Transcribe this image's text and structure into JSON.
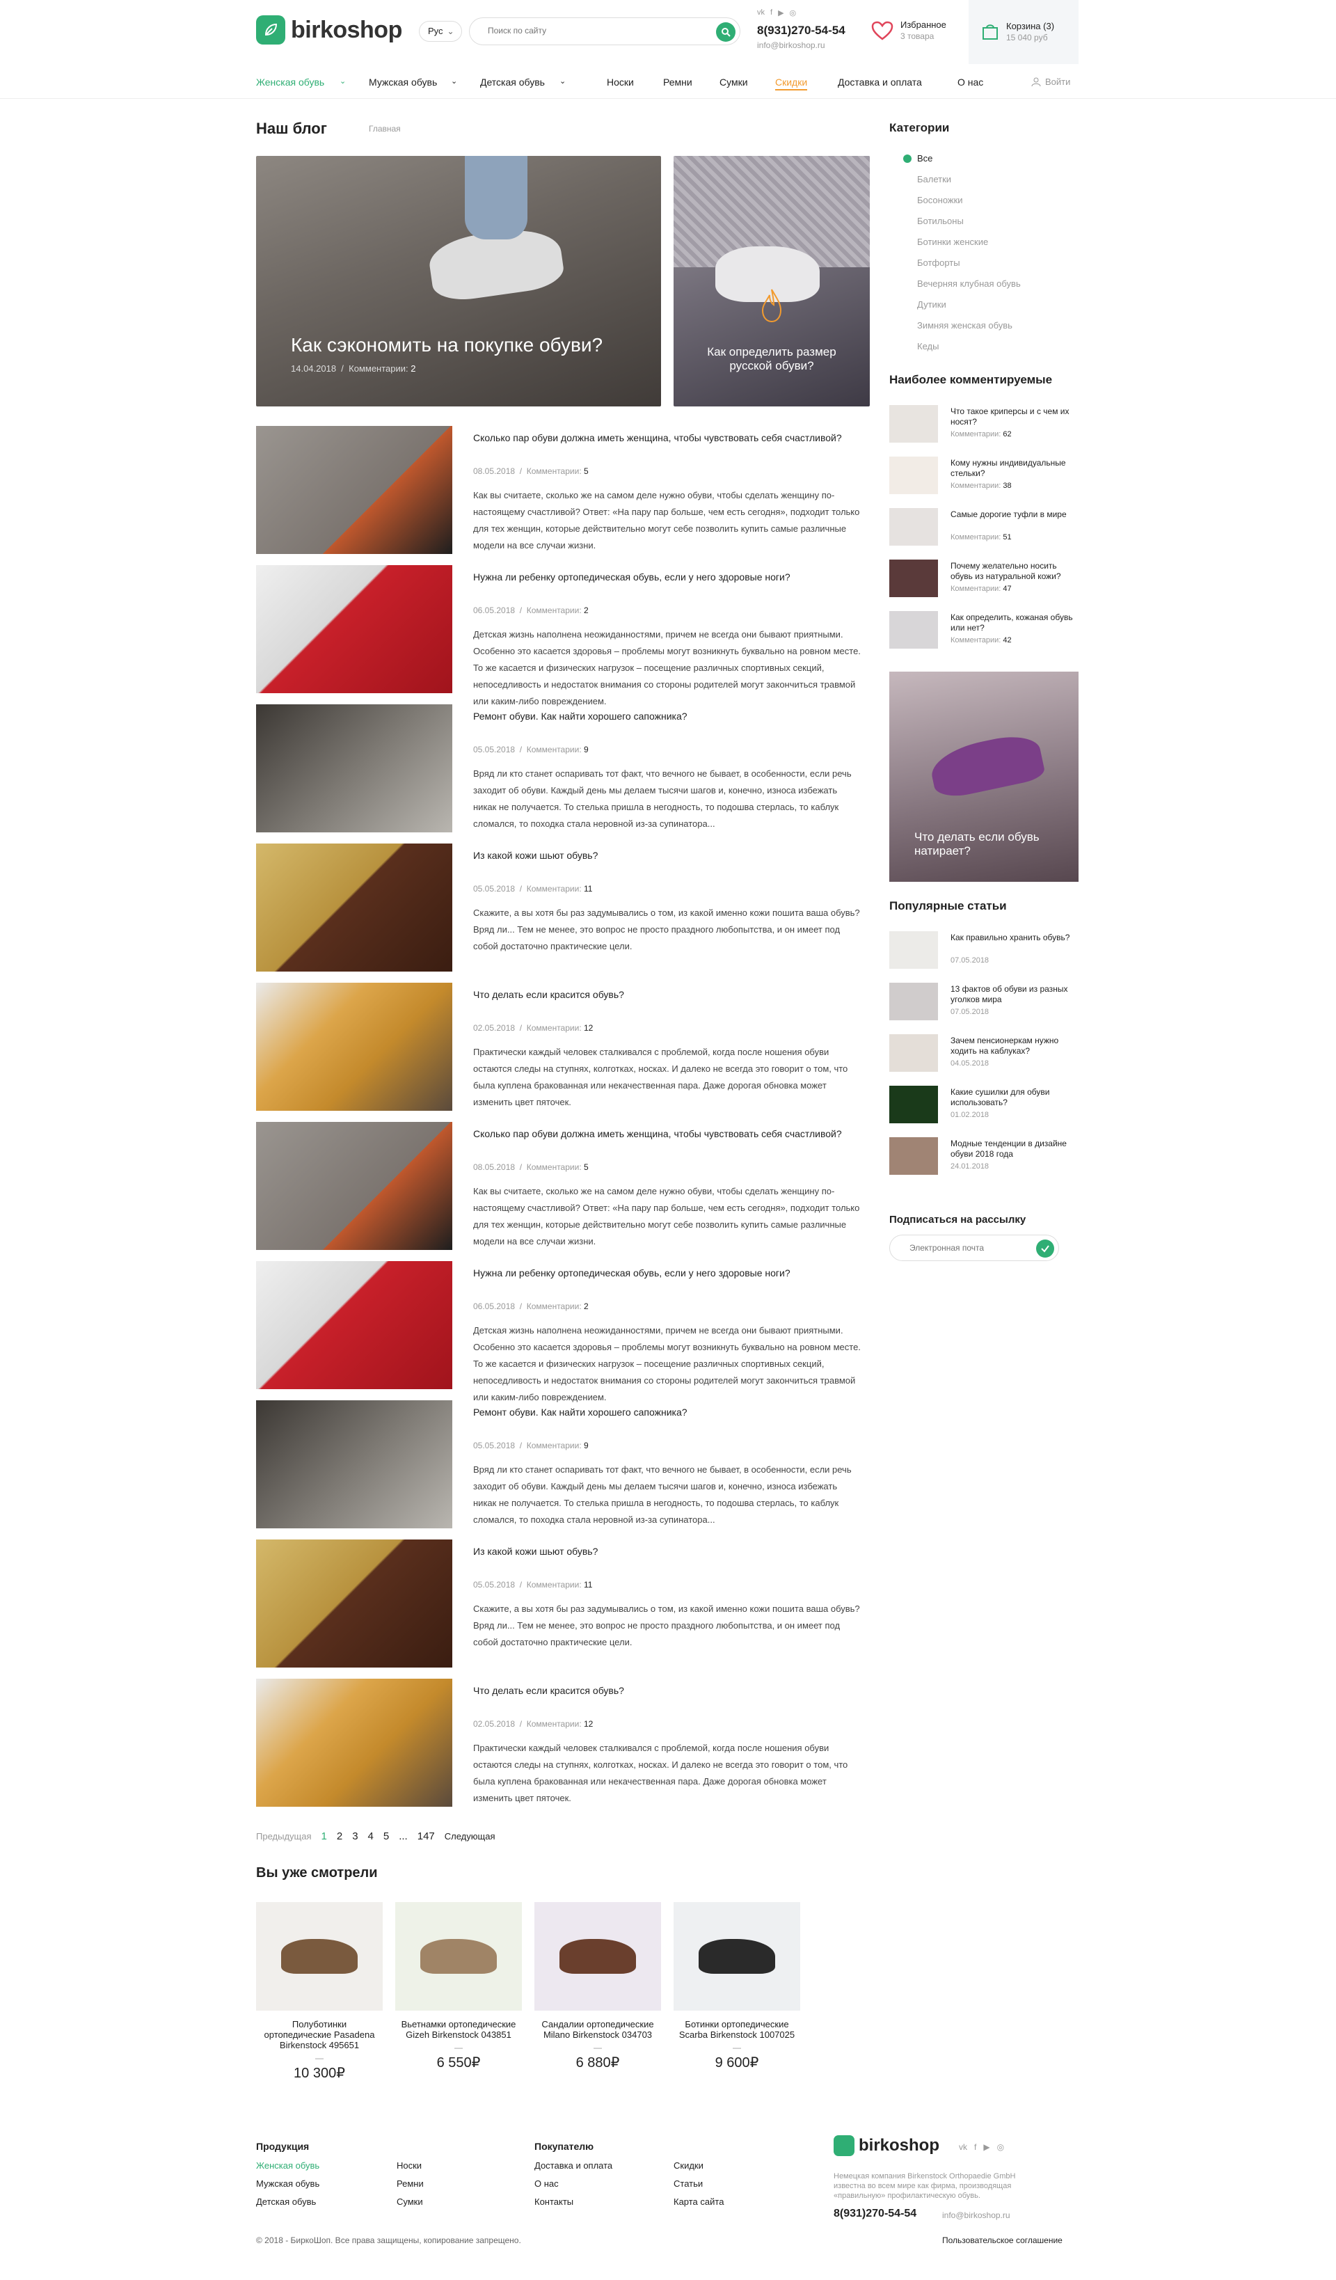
{
  "header": {
    "logo": "birkoshop",
    "lang": "Рус",
    "search_placeholder": "Поиск по сайту",
    "social": [
      "vk",
      "f",
      "yt",
      "ig"
    ],
    "phone": "8(931)270-54-54",
    "email": "info@birkoshop.ru",
    "fav_label": "Избранное",
    "fav_count": "3 товара",
    "cart_label": "Корзина (3)",
    "cart_sum": "15 040 руб"
  },
  "nav": {
    "items": [
      "Женская обувь",
      "Мужская обувь",
      "Детская обувь",
      "Носки",
      "Ремни",
      "Сумки",
      "Скидки",
      "Доставка и оплата",
      "О нас"
    ],
    "login": "Войти"
  },
  "blog": {
    "title": "Наш блог",
    "crumb": "Главная"
  },
  "featured": [
    {
      "title": "Как сэкономить на покупке обуви?",
      "date": "14.04.2018",
      "comments_label": "Комментарии:",
      "comments": "2"
    },
    {
      "title": "Как определить размер русской обуви?"
    }
  ],
  "posts": [
    {
      "title": "Сколько пар обуви должна иметь женщина, чтобы чувствовать себя счастливой?",
      "date": "08.05.2018",
      "comments": "5",
      "body": "Как вы считаете, сколько же на самом деле нужно обуви, чтобы сделать женщину по-настоящему счастливой? Ответ: «На пару пар больше, чем есть сегодня», подходит только для тех женщин, которые действительно могут себе позволить купить самые различные модели на все случаи жизни."
    },
    {
      "title": "Нужна ли ребенку ортопедическая обувь, если у него здоровые ноги?",
      "date": "06.05.2018",
      "comments": "2",
      "body": "Детская жизнь наполнена неожиданностями, причем не всегда они бывают приятными. Особенно это касается здоровья – проблемы могут возникнуть буквально на ровном месте. То же касается и физических нагрузок – посещение различных спортивных секций, непоседливость и недостаток внимания со стороны родителей могут закончиться травмой или каким-либо повреждением."
    },
    {
      "title": "Ремонт обуви. Как найти хорошего сапожника?",
      "date": "05.05.2018",
      "comments": "9",
      "body": "Вряд ли кто станет оспаривать тот факт, что вечного не бывает, в особенности, если речь заходит об обуви. Каждый день мы делаем тысячи шагов и, конечно, износа избежать никак не получается. То стелька пришла в негодность, то подошва стерлась, то каблук сломался, то походка стала неровной из-за супинатора..."
    },
    {
      "title": "Из какой кожи шьют обувь?",
      "date": "05.05.2018",
      "comments": "11",
      "body": "Скажите, а вы хотя бы раз задумывались о том, из какой именно кожи пошита ваша обувь? Вряд ли... Тем не менее, это вопрос не просто праздного любопытства, и он имеет под собой достаточно практические цели."
    },
    {
      "title": "Что делать если красится обувь?",
      "date": "02.05.2018",
      "comments": "12",
      "body": "Практически каждый человек сталкивался с проблемой, когда после ношения обуви остаются следы на ступнях, колготках, носках. И далеко не всегда это говорит о том, что была куплена бракованная или некачественная пара. Даже дорогая обновка может изменить цвет пяточек."
    },
    {
      "title": "Сколько пар обуви должна иметь женщина, чтобы чувствовать себя счастливой?",
      "date": "08.05.2018",
      "comments": "5",
      "body": "Как вы считаете, сколько же на самом деле нужно обуви, чтобы сделать женщину по-настоящему счастливой? Ответ: «На пару пар больше, чем есть сегодня», подходит только для тех женщин, которые действительно могут себе позволить купить самые различные модели на все случаи жизни."
    },
    {
      "title": "Нужна ли ребенку ортопедическая обувь, если у него здоровые ноги?",
      "date": "06.05.2018",
      "comments": "2",
      "body": "Детская жизнь наполнена неожиданностями, причем не всегда они бывают приятными. Особенно это касается здоровья – проблемы могут возникнуть буквально на ровном месте. То же касается и физических нагрузок – посещение различных спортивных секций, непоседливость и недостаток внимания со стороны родителей могут закончиться травмой или каким-либо повреждением."
    },
    {
      "title": "Ремонт обуви. Как найти хорошего сапожника?",
      "date": "05.05.2018",
      "comments": "9",
      "body": "Вряд ли кто станет оспаривать тот факт, что вечного не бывает, в особенности, если речь заходит об обуви. Каждый день мы делаем тысячи шагов и, конечно, износа избежать никак не получается. То стелька пришла в негодность, то подошва стерлась, то каблук сломался, то походка стала неровной из-за супинатора..."
    },
    {
      "title": "Из какой кожи шьют обувь?",
      "date": "05.05.2018",
      "comments": "11",
      "body": "Скажите, а вы хотя бы раз задумывались о том, из какой именно кожи пошита ваша обувь? Вряд ли... Тем не менее, это вопрос не просто праздного любопытства, и он имеет под собой достаточно практические цели."
    },
    {
      "title": "Что делать если красится обувь?",
      "date": "02.05.2018",
      "comments": "12",
      "body": "Практически каждый человек сталкивался с проблемой, когда после ношения обуви остаются следы на ступнях, колготках, носках. И далеко не всегда это говорит о том, что была куплена бракованная или некачественная пара. Даже дорогая обновка может изменить цвет пяточек."
    }
  ],
  "comments_label": "Комментарии:",
  "pager": {
    "prev": "Предыдущая",
    "pages": [
      "1",
      "2",
      "3",
      "4",
      "5",
      "...",
      "147"
    ],
    "next": "Следующая"
  },
  "seen": {
    "title": "Вы уже смотрели",
    "items": [
      {
        "name": "Полуботинки ортопедические Pasadena Birkenstock 495651",
        "price": "10 300₽"
      },
      {
        "name": "Вьетнамки ортопедические Gizeh Birkenstock 043851",
        "price": "6 550₽"
      },
      {
        "name": "Сандалии ортопедические Milano Birkenstock 034703",
        "price": "6 880₽"
      },
      {
        "name": "Ботинки ортопедические Scarba Birkenstock 1007025",
        "price": "9 600₽"
      }
    ]
  },
  "sidebar": {
    "categories_title": "Категории",
    "categories": [
      "Все",
      "Балетки",
      "Босоножки",
      "Ботильоны",
      "Ботинки женские",
      "Ботфорты",
      "Вечерняя клубная обувь",
      "Дутики",
      "Зимняя женская обувь",
      "Кеды"
    ],
    "most_commented_title": "Наиболее комментируемые",
    "most_commented": [
      {
        "title": "Что такое криперсы и с чем их носят?",
        "comments": "62"
      },
      {
        "title": "Кому нужны индивидуальные стельки?",
        "comments": "38"
      },
      {
        "title": "Самые дорогие туфли в мире",
        "comments": "51"
      },
      {
        "title": "Почему желательно носить обувь из натуральной кожи?",
        "comments": "47"
      },
      {
        "title": "Как определить, кожаная обувь или нет?",
        "comments": "42"
      }
    ],
    "banner": "Что делать если обувь натирает?",
    "popular_title": "Популярные статьи",
    "popular": [
      {
        "title": "Как правильно хранить обувь?",
        "date": "07.05.2018"
      },
      {
        "title": "13 фактов об обуви из разных уголков мира",
        "date": "07.05.2018"
      },
      {
        "title": "Зачем пенсионеркам нужно ходить на каблуках?",
        "date": "04.05.2018"
      },
      {
        "title": "Какие сушилки для обуви использовать?",
        "date": "01.02.2018"
      },
      {
        "title": "Модные тенденции в дизайне обуви 2018 года",
        "date": "24.01.2018"
      }
    ],
    "subscribe_title": "Подписаться на рассылку",
    "subscribe_placeholder": "Электронная почта"
  },
  "footer": {
    "col1_title": "Продукция",
    "col1": [
      "Женская обувь",
      "Мужская обувь",
      "Детская обувь"
    ],
    "col1b": [
      "Носки",
      "Ремни",
      "Сумки"
    ],
    "col2_title": "Покупателю",
    "col2": [
      "Доставка и оплата",
      "О нас",
      "Контакты"
    ],
    "col2b": [
      "Скидки",
      "Статьи",
      "Карта сайта"
    ],
    "logo": "birkoshop",
    "desc": "Немецкая компания Birkenstock Orthopaedie GmbH известна во всем мире как фирма, производящая «правильную» профилактическую обувь.",
    "phone": "8(931)270-54-54",
    "email": "info@birkoshop.ru",
    "policy": "Пользовательское соглашение",
    "copyright": "© 2018 - БиркоШоп. Все права защищены, копирование запрещено."
  },
  "colors": {
    "accent": "#2fae74",
    "sale": "#f29b2f"
  }
}
